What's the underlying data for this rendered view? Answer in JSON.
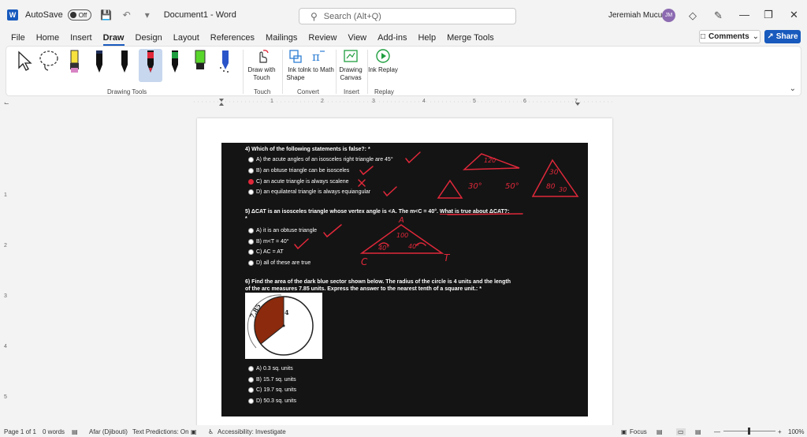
{
  "titlebar": {
    "autosave_label": "AutoSave",
    "autosave_state": "Off",
    "doc_title": "Document1 - Word",
    "search_placeholder": "Search (Alt+Q)",
    "user_name": "Jeremiah Mucunu",
    "user_initials": "JM"
  },
  "menu": {
    "tabs": [
      "File",
      "Home",
      "Insert",
      "Draw",
      "Design",
      "Layout",
      "References",
      "Mailings",
      "Review",
      "View",
      "Add-ins",
      "Help",
      "Merge Tools"
    ],
    "active_tab": "Draw",
    "comments_label": "Comments",
    "share_label": "Share"
  },
  "ribbon": {
    "groups": {
      "drawing_tools": "Drawing Tools",
      "touch": "Touch",
      "convert": "Convert",
      "insert": "Insert",
      "replay": "Replay"
    },
    "buttons": {
      "draw_with_touch": "Draw with Touch",
      "ink_to_shape": "Ink to Shape",
      "ink_to_math": "Ink to Math",
      "drawing_canvas": "Drawing Canvas",
      "ink_replay": "Ink Replay"
    },
    "pen_colors": [
      "#111111",
      "#111111",
      "#e0283a",
      "#1f9e3f",
      "#59d62b",
      "#2a54c9"
    ]
  },
  "ruler": {
    "marks": [
      "1",
      "2",
      "3",
      "4",
      "5",
      "6",
      "7"
    ]
  },
  "vruler": {
    "marks": [
      "1",
      "2",
      "3",
      "4",
      "5"
    ]
  },
  "document": {
    "q4": {
      "title": "4) Which of the following statements is false?: *",
      "options": [
        "A) the acute angles of an isosceles right triangle are 45°",
        "B) an obtuse triangle can be isosceles",
        "C) an acute triangle is always scalene",
        "D) an equilateral triangle is always equiangular"
      ]
    },
    "q5": {
      "title_a": "5) ΔCAT is an isosceles triangle whose vertex angle is <A. The m<C = 40°.",
      "title_b": "What is true about ΔCAT?:",
      "star": "*",
      "options": [
        "A) it is an obtuse triangle",
        "B) m<T = 40°",
        "C) AC = AT",
        "D) all of these are true"
      ]
    },
    "q6": {
      "title": "6) Find the area of the dark blue sector shown below. The radius of the circle is 4 units and the length of the arc measures 7.85 units. Express the answer to the nearest tenth of a square unit.: *",
      "arc_label": "7.85",
      "radius_label": "4",
      "options": [
        "A) 0.3 sq. units",
        "B) 15.7 sq. units",
        "C) 19.7 sq. units",
        "D) 50.3 sq. units"
      ]
    }
  },
  "statusbar": {
    "page": "Page 1 of 1",
    "words": "0 words",
    "language": "Afar (Djibouti)",
    "predictions": "Text Predictions: On",
    "accessibility": "Accessibility: Investigate",
    "focus": "Focus",
    "zoom": "100%"
  }
}
